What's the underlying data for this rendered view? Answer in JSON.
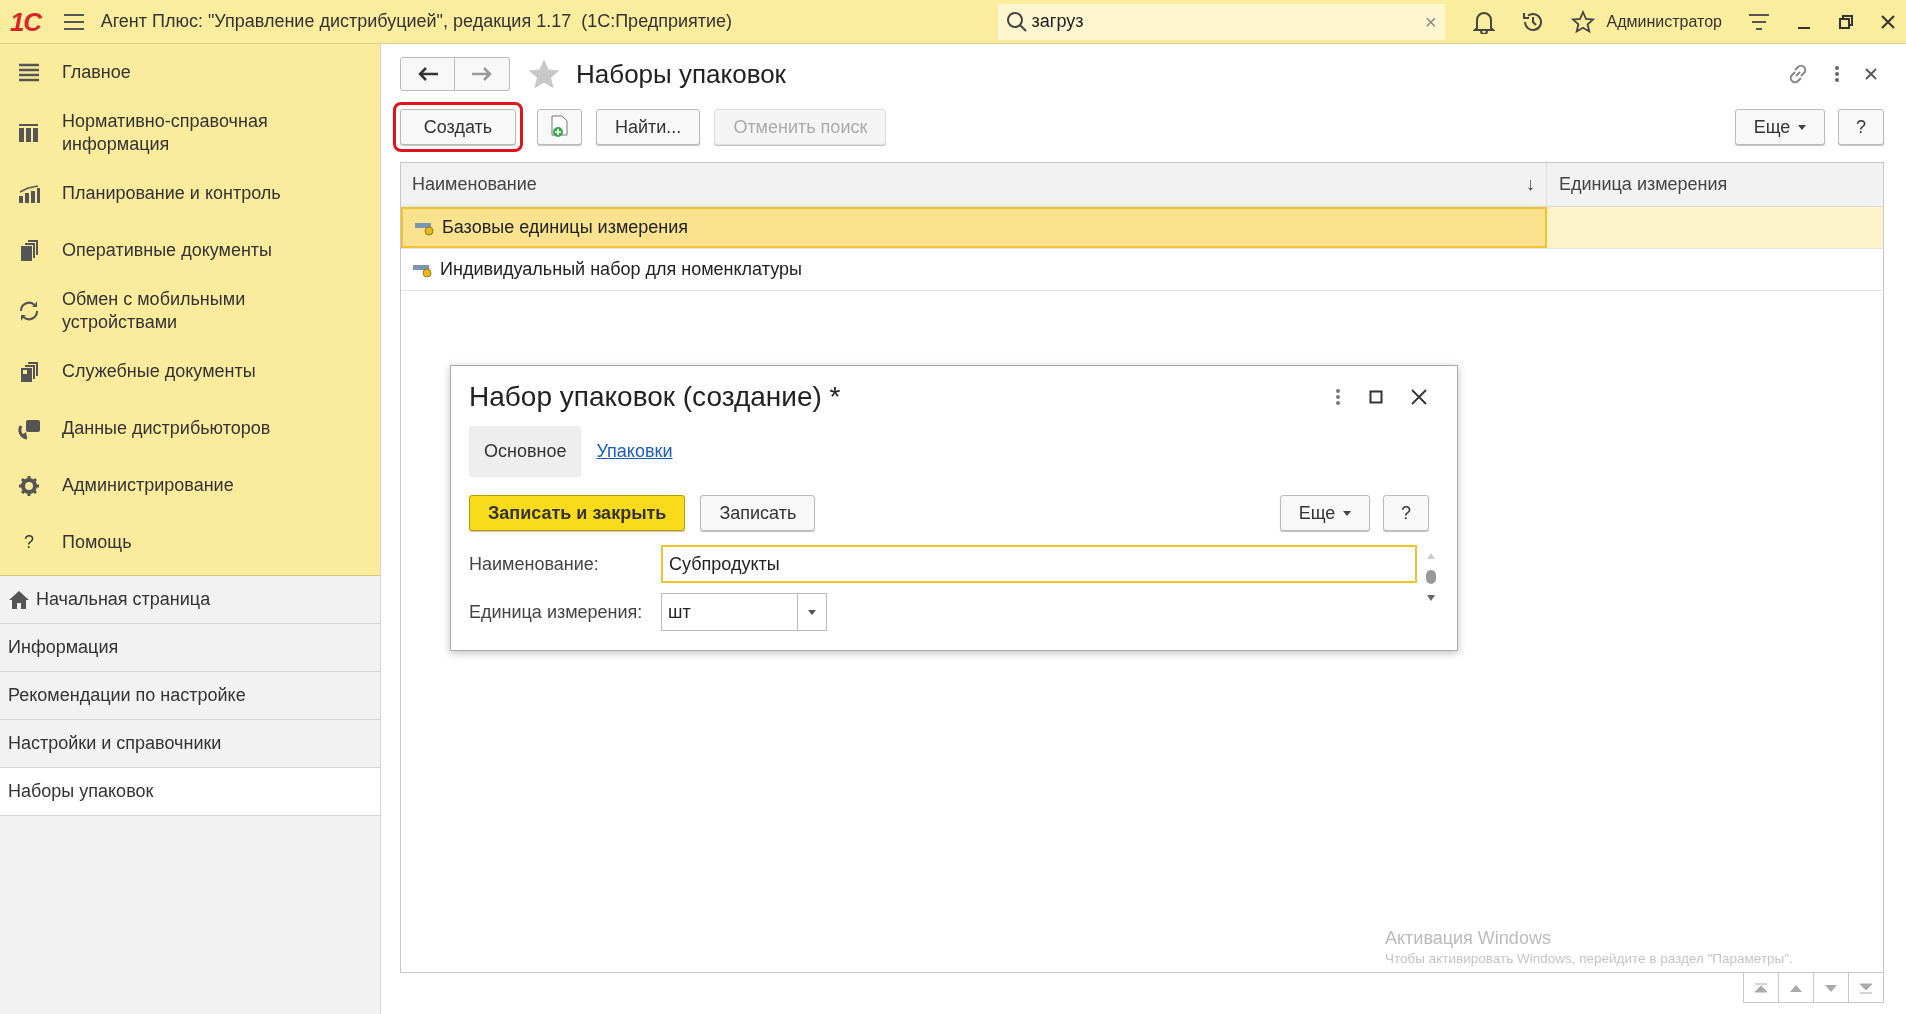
{
  "app_bar": {
    "logo": "1С",
    "title": "Агент Плюс: \"Управление дистрибуцией\", редакция 1.17  (1С:Предприятие)",
    "search": {
      "value": "загруз"
    },
    "clear": "×",
    "user": "Администратор"
  },
  "sections": [
    {
      "label": "Главное"
    },
    {
      "label": "Нормативно-справочная информация"
    },
    {
      "label": "Планирование и контроль"
    },
    {
      "label": "Оперативные документы"
    },
    {
      "label": "Обмен с мобильными устройствами"
    },
    {
      "label": "Служебные документы"
    },
    {
      "label": "Данные дистрибьюторов"
    },
    {
      "label": "Администрирование"
    },
    {
      "label": "Помощь",
      "glyph": "?"
    }
  ],
  "open_windows": [
    {
      "label": "Начальная страница",
      "kind": "home",
      "selected": false
    },
    {
      "label": "Информация",
      "kind": "page",
      "selected": false
    },
    {
      "label": "Рекомендации по настройке",
      "kind": "page",
      "selected": false
    },
    {
      "label": "Настройки и справочники",
      "kind": "page",
      "selected": false
    },
    {
      "label": "Наборы упаковок",
      "kind": "page",
      "selected": true
    }
  ],
  "form": {
    "title": "Наборы упаковок",
    "toolbar": [
      {
        "kind": "text",
        "label": "Создать",
        "highlighted": true,
        "disabled": false
      },
      {
        "kind": "icon"
      },
      {
        "kind": "text",
        "label": "Найти...",
        "highlighted": false,
        "disabled": false
      },
      {
        "kind": "text",
        "label": "Отменить поиск",
        "highlighted": false,
        "disabled": true
      }
    ],
    "toolbar_right": [
      {
        "label": "Еще",
        "menu": true
      },
      {
        "label": "?",
        "menu": false
      }
    ],
    "table": {
      "columns": [
        {
          "label": "Наименование",
          "sort": "↓"
        },
        {
          "label": "Единица измерения"
        }
      ],
      "rows": [
        {
          "name": "Базовые единицы измерения",
          "selected": true
        },
        {
          "name": "Индивидуальный набор для номенклатуры",
          "selected": false
        }
      ]
    }
  },
  "dialog": {
    "title": "Набор упаковок (создание) *",
    "tabs": [
      {
        "label": "Основное",
        "selected": true
      },
      {
        "label": "Упаковки",
        "selected": false
      }
    ],
    "buttons": [
      {
        "label": "Записать и закрыть",
        "kind": "primary"
      },
      {
        "label": "Записать",
        "kind": "default"
      }
    ],
    "buttons_right": [
      {
        "label": "Еще",
        "menu": true
      },
      {
        "label": "?",
        "menu": false
      }
    ],
    "fields": [
      {
        "label": "Наименование:",
        "value": "Субпродукты",
        "kind": "text",
        "focused": true
      },
      {
        "label": "Единица измерения:",
        "value": "шт",
        "kind": "dropdown",
        "focused": false
      }
    ]
  },
  "watermark": {
    "title": "Активация Windows",
    "text": "Чтобы активировать Windows, перейдите в раздел \"Параметры\"."
  }
}
